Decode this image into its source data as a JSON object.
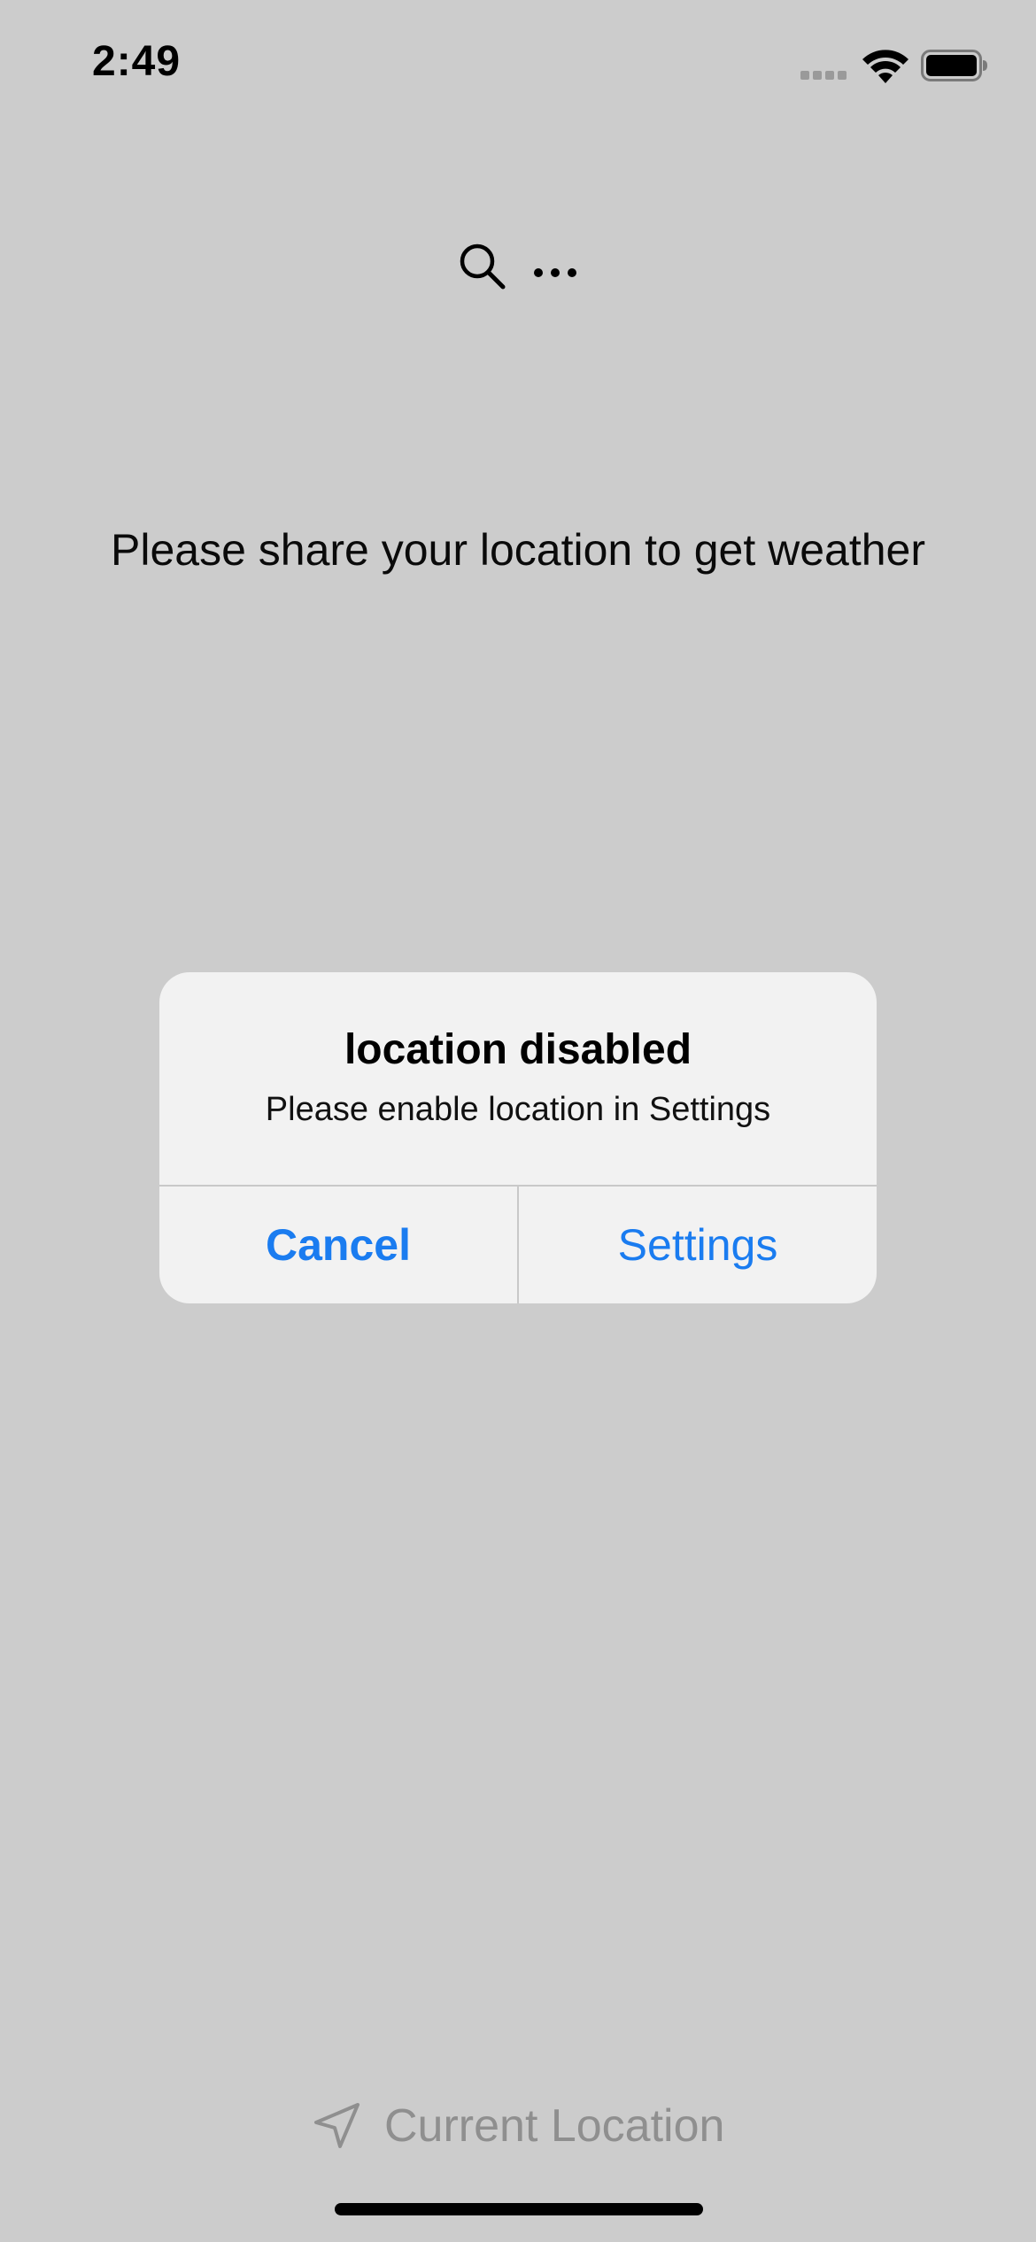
{
  "status_bar": {
    "time": "2:49",
    "signal_icon": "cellular-signal-icon",
    "wifi_icon": "wifi-icon",
    "battery_icon": "battery-icon"
  },
  "toolbar": {
    "search_icon": "search-icon",
    "more_icon": "ellipsis-icon"
  },
  "main": {
    "prompt": "Please share your location to get weather"
  },
  "alert": {
    "title": "location disabled",
    "message": "Please enable location in Settings",
    "cancel_label": "Cancel",
    "settings_label": "Settings"
  },
  "footer": {
    "current_location_label": "Current Location",
    "location_icon": "location-arrow-icon"
  },
  "colors": {
    "background": "#cccccc",
    "alert_background": "#f2f2f2",
    "accent": "#1a7cf0",
    "muted": "#8f8f8f"
  }
}
